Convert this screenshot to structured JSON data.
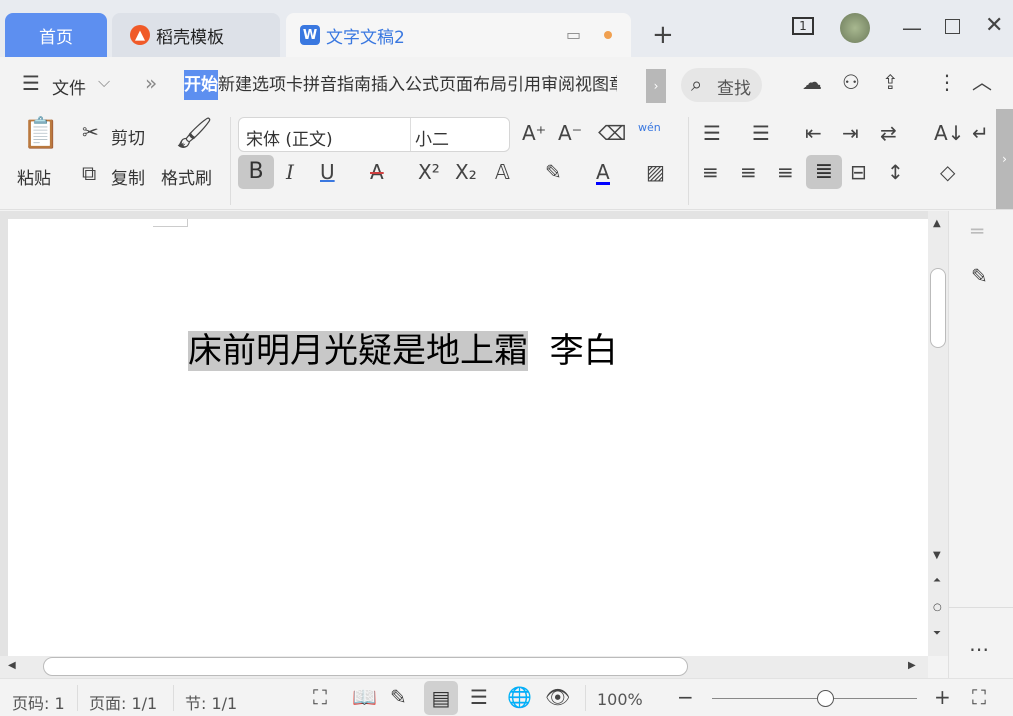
{
  "tabs": {
    "home": "首页",
    "daoke": "稻壳模板",
    "doc": "文字文稿2",
    "new_tab": "+"
  },
  "window": {
    "tab_count": "1"
  },
  "menu": {
    "file": "文件",
    "items": [
      "开始",
      "新建选项卡",
      "拼音指南",
      "插入",
      "公式",
      "页面布局",
      "引用",
      "审阅",
      "视图",
      "章"
    ],
    "search": "查找"
  },
  "ribbon": {
    "paste": "粘贴",
    "cut": "剪切",
    "copy": "复制",
    "format_painter": "格式刷",
    "font_name": "宋体 (正文)",
    "font_size": "小二",
    "pinyin": "wén"
  },
  "document": {
    "selected_text": "床前明月光疑是地上霜",
    "text": "李白"
  },
  "status": {
    "page_num": "页码: 1",
    "pages": "页面: 1/1",
    "section": "节: 1/1",
    "zoom": "100%",
    "zoom_fraction": 0.55
  },
  "colors": {
    "accent": "#5d8ff0",
    "selection": "#c8c8c8",
    "font_color": "#0000ff",
    "underline": "#3a78e0"
  }
}
